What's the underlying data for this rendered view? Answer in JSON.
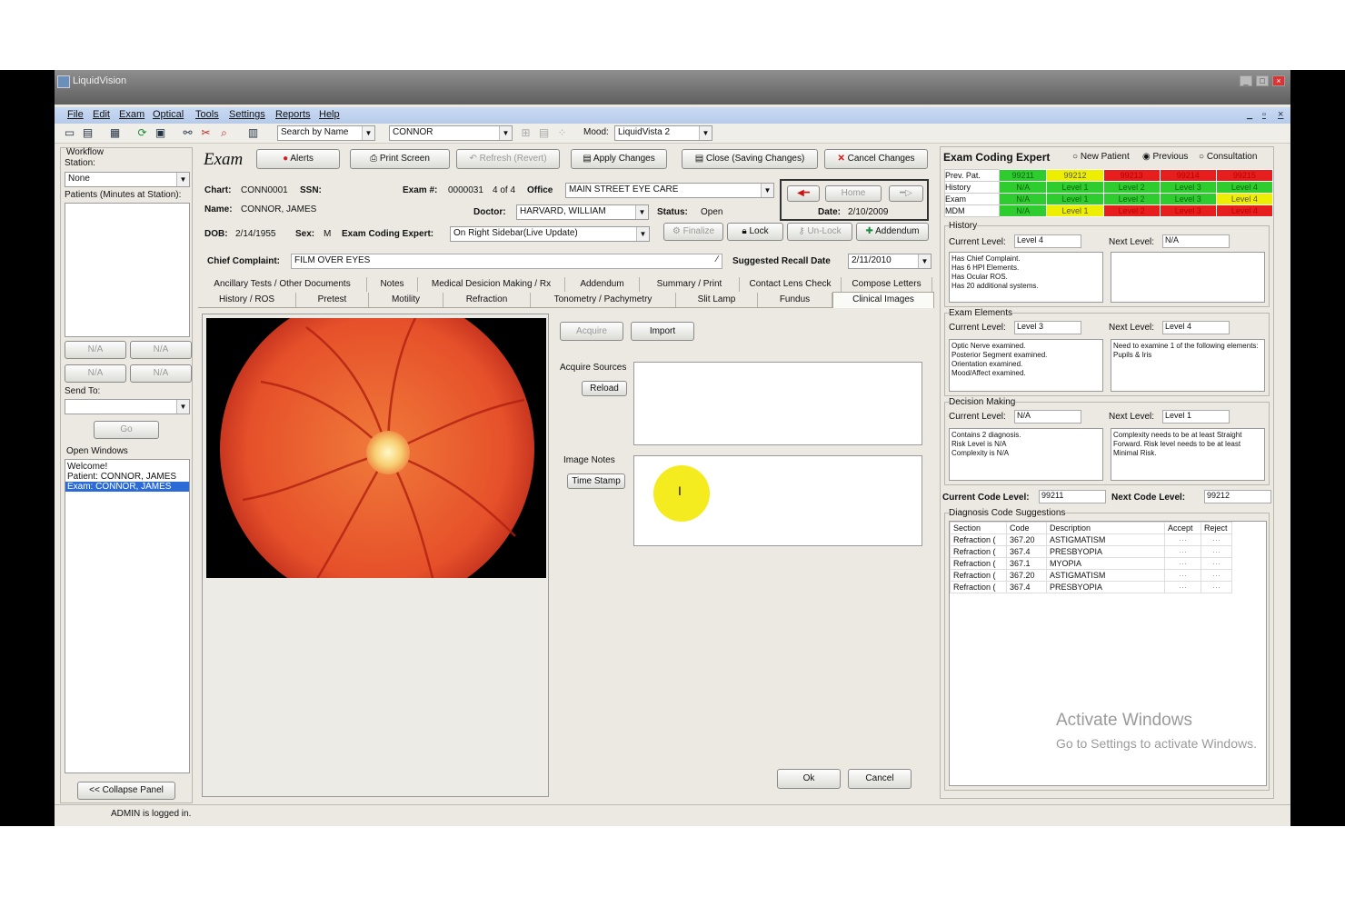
{
  "app": {
    "title": "LiquidVision"
  },
  "menu": [
    "File",
    "Edit",
    "Exam",
    "Optical",
    "Tools",
    "Settings",
    "Reports",
    "Help"
  ],
  "toolbar": {
    "search_mode": "Search by Name",
    "patient_search": "CONNOR",
    "mood_label": "Mood:",
    "mood_value": "LiquidVista 2"
  },
  "left": {
    "workflow": "Workflow",
    "station_label": "Station:",
    "station_value": "None",
    "patients_label": "Patients (Minutes at Station):",
    "na": "N/A",
    "send_to": "Send To:",
    "go": "Go",
    "open_windows": "Open Windows",
    "windows": [
      "Welcome!",
      "Patient: CONNOR, JAMES",
      "Exam: CONNOR, JAMES"
    ],
    "collapse": "<< Collapse Panel"
  },
  "exam": {
    "title": "Exam",
    "alerts": "Alerts",
    "print_screen": "Print Screen",
    "refresh": "Refresh (Revert)",
    "apply": "Apply Changes",
    "close": "Close (Saving Changes)",
    "cancel_changes": "Cancel Changes",
    "chart_label": "Chart:",
    "chart": "CONN0001",
    "ssn_label": "SSN:",
    "exam_label": "Exam #:",
    "exam_no": "0000031",
    "of": "4 of 4",
    "office_label": "Office",
    "office": "MAIN STREET EYE CARE",
    "name_label": "Name:",
    "name": "CONNOR, JAMES",
    "doctor_label": "Doctor:",
    "doctor": "HARVARD, WILLIAM",
    "status_label": "Status:",
    "status": "Open",
    "dob_label": "DOB:",
    "dob": "2/14/1955",
    "sex_label": "Sex:",
    "sex": "M",
    "ece_label": "Exam Coding Expert:",
    "ece": "On Right Sidebar(Live Update)",
    "home": "Home",
    "date_label": "Date:",
    "date": "2/10/2009",
    "finalize": "Finalize",
    "lock": "Lock",
    "unlock": "Un-Lock",
    "addendum": "Addendum",
    "cc_label": "Chief Complaint:",
    "cc": "FILM OVER EYES",
    "recall_label": "Suggested Recall Date",
    "recall": "2/11/2010"
  },
  "tabs_row1": [
    "Ancillary Tests / Other Documents",
    "Notes",
    "Medical Desicion Making / Rx",
    "Addendum",
    "Summary / Print",
    "Contact Lens Check",
    "Compose Letters"
  ],
  "tabs_row2": [
    "History / ROS",
    "Pretest",
    "Motility",
    "Refraction",
    "Tonometry / Pachymetry",
    "Slit Lamp",
    "Fundus",
    "Clinical Images"
  ],
  "images": {
    "acquire": "Acquire",
    "import": "Import",
    "acquire_sources": "Acquire Sources",
    "reload": "Reload",
    "image_notes": "Image Notes",
    "time_stamp": "Time Stamp",
    "ok": "Ok",
    "cancel": "Cancel"
  },
  "coding": {
    "title": "Exam Coding Expert",
    "new_patient": "New Patient",
    "previous": "Previous",
    "consultation": "Consultation",
    "grid": [
      {
        "label": "Prev. Pat.",
        "cells": [
          [
            "99211",
            "g"
          ],
          [
            "99212",
            "y"
          ],
          [
            "99213",
            "r"
          ],
          [
            "99214",
            "r"
          ],
          [
            "99215",
            "r"
          ]
        ]
      },
      {
        "label": "History",
        "cells": [
          [
            "N/A",
            "g"
          ],
          [
            "Level 1",
            "g"
          ],
          [
            "Level 2",
            "g"
          ],
          [
            "Level 3",
            "g"
          ],
          [
            "Level 4",
            "g"
          ]
        ]
      },
      {
        "label": "Exam",
        "cells": [
          [
            "N/A",
            "g"
          ],
          [
            "Level 1",
            "g"
          ],
          [
            "Level 2",
            "g"
          ],
          [
            "Level 3",
            "g"
          ],
          [
            "Level 4",
            "y"
          ]
        ]
      },
      {
        "label": "MDM",
        "cells": [
          [
            "N/A",
            "g"
          ],
          [
            "Level 1",
            "y"
          ],
          [
            "Level 2",
            "r"
          ],
          [
            "Level 3",
            "r"
          ],
          [
            "Level 4",
            "r"
          ]
        ]
      }
    ],
    "history": {
      "title": "History",
      "current_label": "Current Level:",
      "current": "Level 4",
      "next_label": "Next Level:",
      "next": "N/A",
      "left_text": "Has Chief Complaint.\nHas 6 HPI Elements.\nHas Ocular ROS.\nHas 20 additional systems.",
      "right_text": ""
    },
    "exam_el": {
      "title": "Exam Elements",
      "current_label": "Current Level:",
      "current": "Level 3",
      "next_label": "Next Level:",
      "next": "Level 4",
      "left_text": "Optic Nerve examined.\nPosterior Segment examined.\nOrientation examined.\nMood/Affect examined.",
      "right_text": "Need to examine 1 of the following elements: Pupils & Iris"
    },
    "decision": {
      "title": "Decision Making",
      "current_label": "Current Level:",
      "current": "N/A",
      "next_label": "Next Level:",
      "next": "Level 1",
      "left_text": "Contains 2 diagnosis.\nRisk Level is N/A\nComplexity is N/A",
      "right_text": "Complexity needs to be at least Straight Forward.\nRisk level needs to be at least Minimal Risk."
    },
    "ccl_label": "Current Code Level:",
    "ccl": "99211",
    "ncl_label": "Next Code Level:",
    "ncl": "99212",
    "diag_title": "Diagnosis Code Suggestions",
    "diag_headers": [
      "Section",
      "Code",
      "Description",
      "Accept",
      "Reject"
    ],
    "diag_rows": [
      [
        "Refraction (",
        "367.20",
        "ASTIGMATISM"
      ],
      [
        "Refraction (",
        "367.4",
        "PRESBYOPIA"
      ],
      [
        "Refraction (",
        "367.1",
        "MYOPIA"
      ],
      [
        "Refraction (",
        "367.20",
        "ASTIGMATISM"
      ],
      [
        "Refraction (",
        "367.4",
        "PRESBYOPIA"
      ]
    ]
  },
  "watermark": {
    "line1": "Activate Windows",
    "line2": "Go to Settings to activate Windows."
  },
  "status": {
    "text": "ADMIN is logged in."
  }
}
